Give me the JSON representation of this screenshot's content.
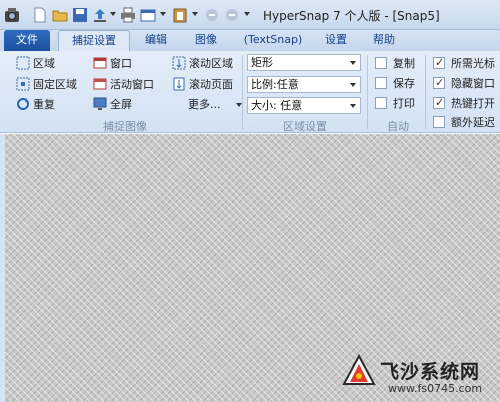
{
  "window": {
    "title": "HyperSnap 7 个人版 - [Snap5]"
  },
  "tabs": [
    {
      "label": "文件"
    },
    {
      "label": "捕捉设置"
    },
    {
      "label": "编辑"
    },
    {
      "label": "图像"
    },
    {
      "label": "(TextSnap)"
    },
    {
      "label": "设置"
    },
    {
      "label": "帮助"
    }
  ],
  "capture_group": {
    "label": "捕捉图像",
    "items": [
      "区域",
      "固定区域",
      "重复",
      "窗口",
      "活动窗口",
      "全屏",
      "滚动区域",
      "滚动页面",
      "更多..."
    ]
  },
  "region_group": {
    "label": "区域设置",
    "shape": "矩形",
    "ratio": "比例:任意",
    "size": "大小: 任意"
  },
  "auto_group": {
    "label": "自动",
    "items": [
      {
        "label": "复制",
        "checked": false
      },
      {
        "label": "保存",
        "checked": false
      },
      {
        "label": "打印",
        "checked": false
      }
    ]
  },
  "options_group": {
    "items": [
      {
        "label": "所需光标",
        "checked": true
      },
      {
        "label": "隐藏窗口",
        "checked": true
      },
      {
        "label": "热键打开",
        "checked": true
      },
      {
        "label": "额外延迟",
        "checked": false
      }
    ]
  },
  "watermark": {
    "name": "飞沙系统网",
    "url": "www.fs0745.com"
  },
  "colors": {
    "file_tab": "#2f6cbf",
    "ribbon": "#dfe9f5",
    "workspace": "#c9c9c9"
  }
}
